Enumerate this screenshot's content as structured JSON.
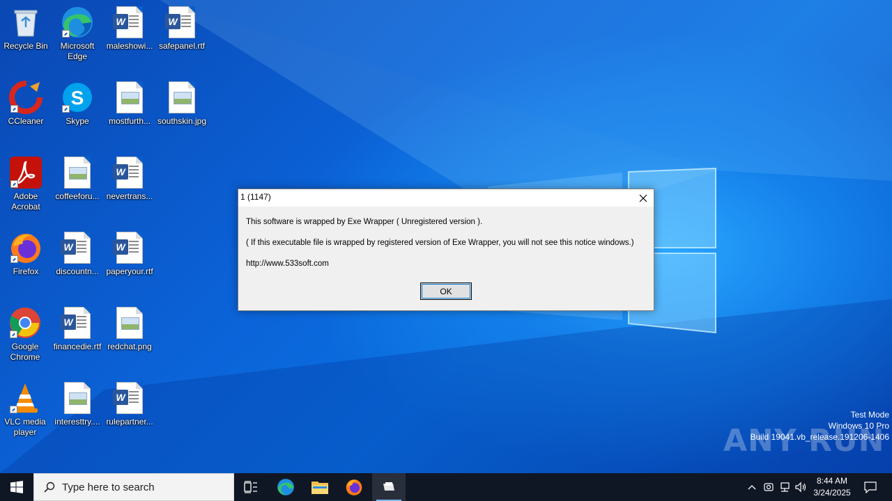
{
  "desktop": {
    "icons": [
      {
        "label": "Recycle Bin",
        "icon": "recycle-bin-icon"
      },
      {
        "label": "Microsoft Edge",
        "icon": "edge-icon"
      },
      {
        "label": "maleshowi...",
        "icon": "word-document-icon"
      },
      {
        "label": "safepanel.rtf",
        "icon": "word-document-icon"
      },
      {
        "label": "CCleaner",
        "icon": "ccleaner-icon"
      },
      {
        "label": "Skype",
        "icon": "skype-icon"
      },
      {
        "label": "mostfurth...",
        "icon": "image-file-icon"
      },
      {
        "label": "southskin.jpg",
        "icon": "image-file-icon"
      },
      {
        "label": "Adobe Acrobat",
        "icon": "acrobat-icon"
      },
      {
        "label": "coffeeforu...",
        "icon": "image-file-icon"
      },
      {
        "label": "nevertrans...",
        "icon": "word-document-icon"
      },
      {
        "label": "Firefox",
        "icon": "firefox-icon"
      },
      {
        "label": "discountn...",
        "icon": "word-document-icon"
      },
      {
        "label": "paperyour.rtf",
        "icon": "word-document-icon"
      },
      {
        "label": "Google Chrome",
        "icon": "chrome-icon"
      },
      {
        "label": "financedie.rtf",
        "icon": "word-document-icon"
      },
      {
        "label": "redchat.png",
        "icon": "image-file-icon"
      },
      {
        "label": "VLC media player",
        "icon": "vlc-icon"
      },
      {
        "label": "interesttry....",
        "icon": "image-file-icon"
      },
      {
        "label": "rulepartner...",
        "icon": "word-document-icon"
      }
    ]
  },
  "dialog": {
    "title": "1 (1147)",
    "message_line1": "This software is wrapped by Exe Wrapper ( Unregistered version ).",
    "message_line2": "( If this executable file is wrapped by registered version of Exe Wrapper, you will not see this notice windows.)",
    "message_line3": "http://www.533soft.com",
    "ok_label": "OK"
  },
  "watermark": {
    "brand": "ANY RUN",
    "line1": "Test Mode",
    "line2": "Windows 10 Pro",
    "line3": "Build 19041.vb_release.191206-1406"
  },
  "taskbar": {
    "search_placeholder": "Type here to search",
    "clock_time": "8:44 AM",
    "clock_date": "3/24/2025",
    "pinned": [
      "task-view-icon",
      "edge-icon",
      "file-explorer-icon",
      "firefox-icon",
      "app-window-icon"
    ]
  },
  "colors": {
    "taskbar": "#101724",
    "accent": "#0078d7",
    "dialog_bg": "#f0f0f0"
  }
}
